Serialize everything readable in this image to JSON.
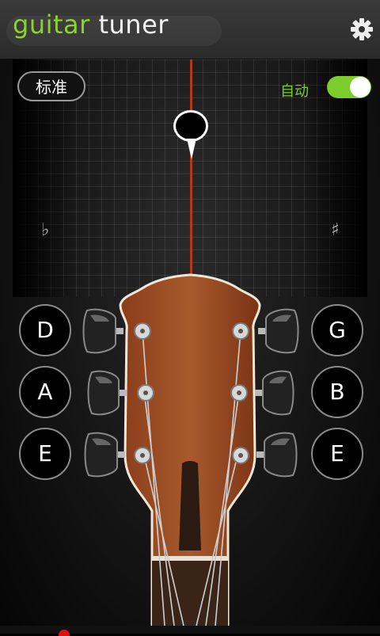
{
  "header": {
    "title_part1": "guitar",
    "title_part2": "tuner",
    "settings_icon": "gear-icon"
  },
  "controls": {
    "standard_label": "标准",
    "auto_label": "自动",
    "auto_toggle_on": true,
    "accent_color": "#7ccc2b"
  },
  "tuner": {
    "flat_symbol": "♭",
    "sharp_symbol": "♯"
  },
  "strings": {
    "left": [
      "D",
      "A",
      "E"
    ],
    "right": [
      "G",
      "B",
      "E"
    ]
  }
}
